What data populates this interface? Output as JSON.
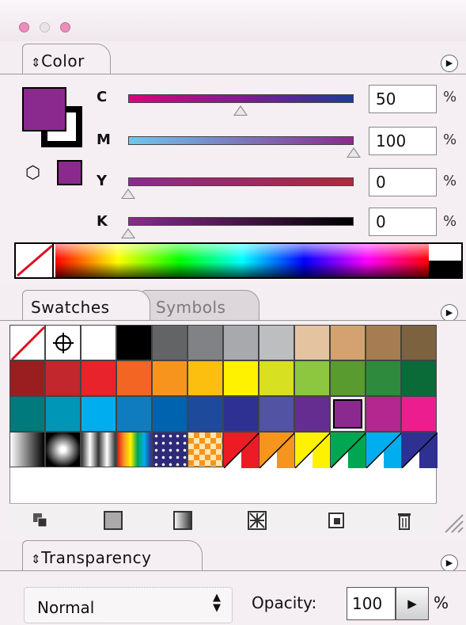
{
  "color_panel": {
    "tab_label": "Color",
    "channels": [
      {
        "label": "C",
        "value": "50",
        "unit": "%",
        "fraction": 0.5
      },
      {
        "label": "M",
        "value": "100",
        "unit": "%",
        "fraction": 1.0
      },
      {
        "label": "Y",
        "value": "0",
        "unit": "%",
        "fraction": 0.0
      },
      {
        "label": "K",
        "value": "0",
        "unit": "%",
        "fraction": 0.0
      }
    ],
    "fill_color": "#8b2a8e"
  },
  "swatches_panel": {
    "tabs": [
      {
        "label": "Swatches",
        "active": true
      },
      {
        "label": "Symbols",
        "active": false
      }
    ],
    "rows": [
      [
        "none",
        "registration",
        "#ffffff",
        "#000000",
        "#636466",
        "#808285",
        "#a7a9ac",
        "#bcbec0",
        "#e4c3a1",
        "#d4a270",
        "#a67c52",
        "#7d6240"
      ],
      [
        "#9a1d20",
        "#c1272d",
        "#e8232b",
        "#f26522",
        "#f7941d",
        "#fcbf10",
        "#fff200",
        "#d7e021",
        "#8dc63f",
        "#5a9b2f",
        "#2e8b3d",
        "#0a6b38"
      ],
      [
        "#007a7c",
        "#0096b8",
        "#00aeef",
        "#0f7cc0",
        "#0063b0",
        "#1e4a9b",
        "#2e3192",
        "#5253a3",
        "#662d91",
        "#8b2a8e",
        "#b3278f",
        "#ec1e8f"
      ],
      [
        "gradient-linear",
        "gradient-radial",
        "gradient-cylinder",
        "gradient-rainbow",
        "pattern-stars",
        "pattern-diamonds",
        "corner:#ed1c24",
        "corner:#f7941d",
        "corner:#fff200",
        "corner:#00a651",
        "corner:#00aeef",
        "corner:#2e3192"
      ]
    ],
    "selected": "#8b2a8e",
    "bottom_buttons": [
      "swatch-libraries-icon",
      "show-color-swatches-icon",
      "show-gradient-swatches-icon",
      "show-pattern-swatches-icon",
      "new-swatch-icon",
      "trash-icon"
    ]
  },
  "transparency_panel": {
    "tab_label": "Transparency",
    "blend_mode": "Normal",
    "opacity_label": "Opacity:",
    "opacity_value": "100",
    "opacity_unit": "%"
  }
}
